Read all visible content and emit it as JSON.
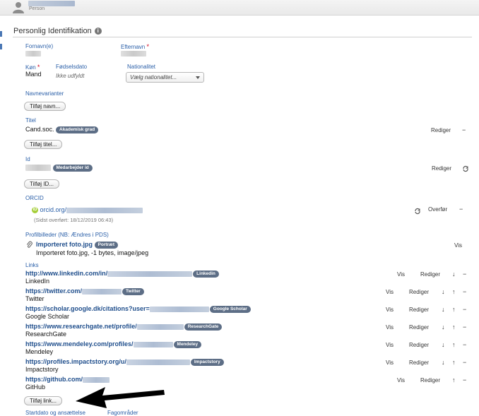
{
  "header": {
    "person_label": "Person"
  },
  "section": {
    "title": "Personlig Identifikation",
    "info_icon": "info-icon"
  },
  "fields": {
    "first_name_label": "Fornavn(e)",
    "last_name_label": "Efternavn",
    "required_mark": "*",
    "gender_label": "Køn",
    "gender_value": "Mand",
    "birthdate_label": "Fødselsdato",
    "birthdate_value": "Ikke udfyldt",
    "nationality_label": "Nationalitet",
    "nationality_placeholder": "Vælg nationalitet...",
    "name_variants_label": "Navnevarianter",
    "add_name_button": "Tilføj navn...",
    "title_label": "Titel",
    "title_value": "Cand.soc.",
    "title_badge": "Akademisk grad",
    "edit_label": "Rediger",
    "remove_label": "−",
    "add_title_button": "Tilføj titel...",
    "id_label": "Id",
    "id_badge": "Medarbejder id",
    "add_id_button": "Tilføj ID..."
  },
  "orcid": {
    "label": "ORCID",
    "icon_text": "iD",
    "link_prefix": "orcid.org/",
    "transfer_note": "(Sidst overført: 18/12/2019 06:43)",
    "transfer_label": "Overfør",
    "remove_label": "−"
  },
  "profile_images": {
    "label": "Profilbilleder (NB: Ændres i PDS)",
    "file_name": "Importeret foto.jpg",
    "badge": "Portræt",
    "description": "Importeret foto.jpg, -1 bytes, image/jpeg",
    "view_label": "Vis"
  },
  "links": {
    "label": "Links",
    "view_label": "Vis",
    "edit_label": "Rediger",
    "down_arrow": "↓",
    "up_arrow": "↑",
    "remove_label": "−",
    "items": [
      {
        "url": "http://www.linkedin.com/in/",
        "badge": "Linkedin",
        "name": "LinkedIn"
      },
      {
        "url": "https://twitter.com/",
        "badge": "Twitter",
        "name": "Twitter"
      },
      {
        "url": "https://scholar.google.dk/citations?user=",
        "badge": "Google Scholar",
        "name": "Google Scholar"
      },
      {
        "url": "https://www.researchgate.net/profile/",
        "badge": "ResearchGate",
        "name": "ResearchGate"
      },
      {
        "url": "https://www.mendeley.com/profiles/",
        "badge": "Mendeley",
        "name": "Mendeley"
      },
      {
        "url": "https://profiles.impactstory.org/u/",
        "badge": "Impactstory",
        "name": "Impactstory"
      },
      {
        "url": "https://github.com/",
        "badge": "",
        "name": "GitHub"
      }
    ],
    "add_link_button": "Tilføj link..."
  },
  "footer_cutoff": {
    "left": "Startdato og ansættelse",
    "right": "Fagområder"
  }
}
